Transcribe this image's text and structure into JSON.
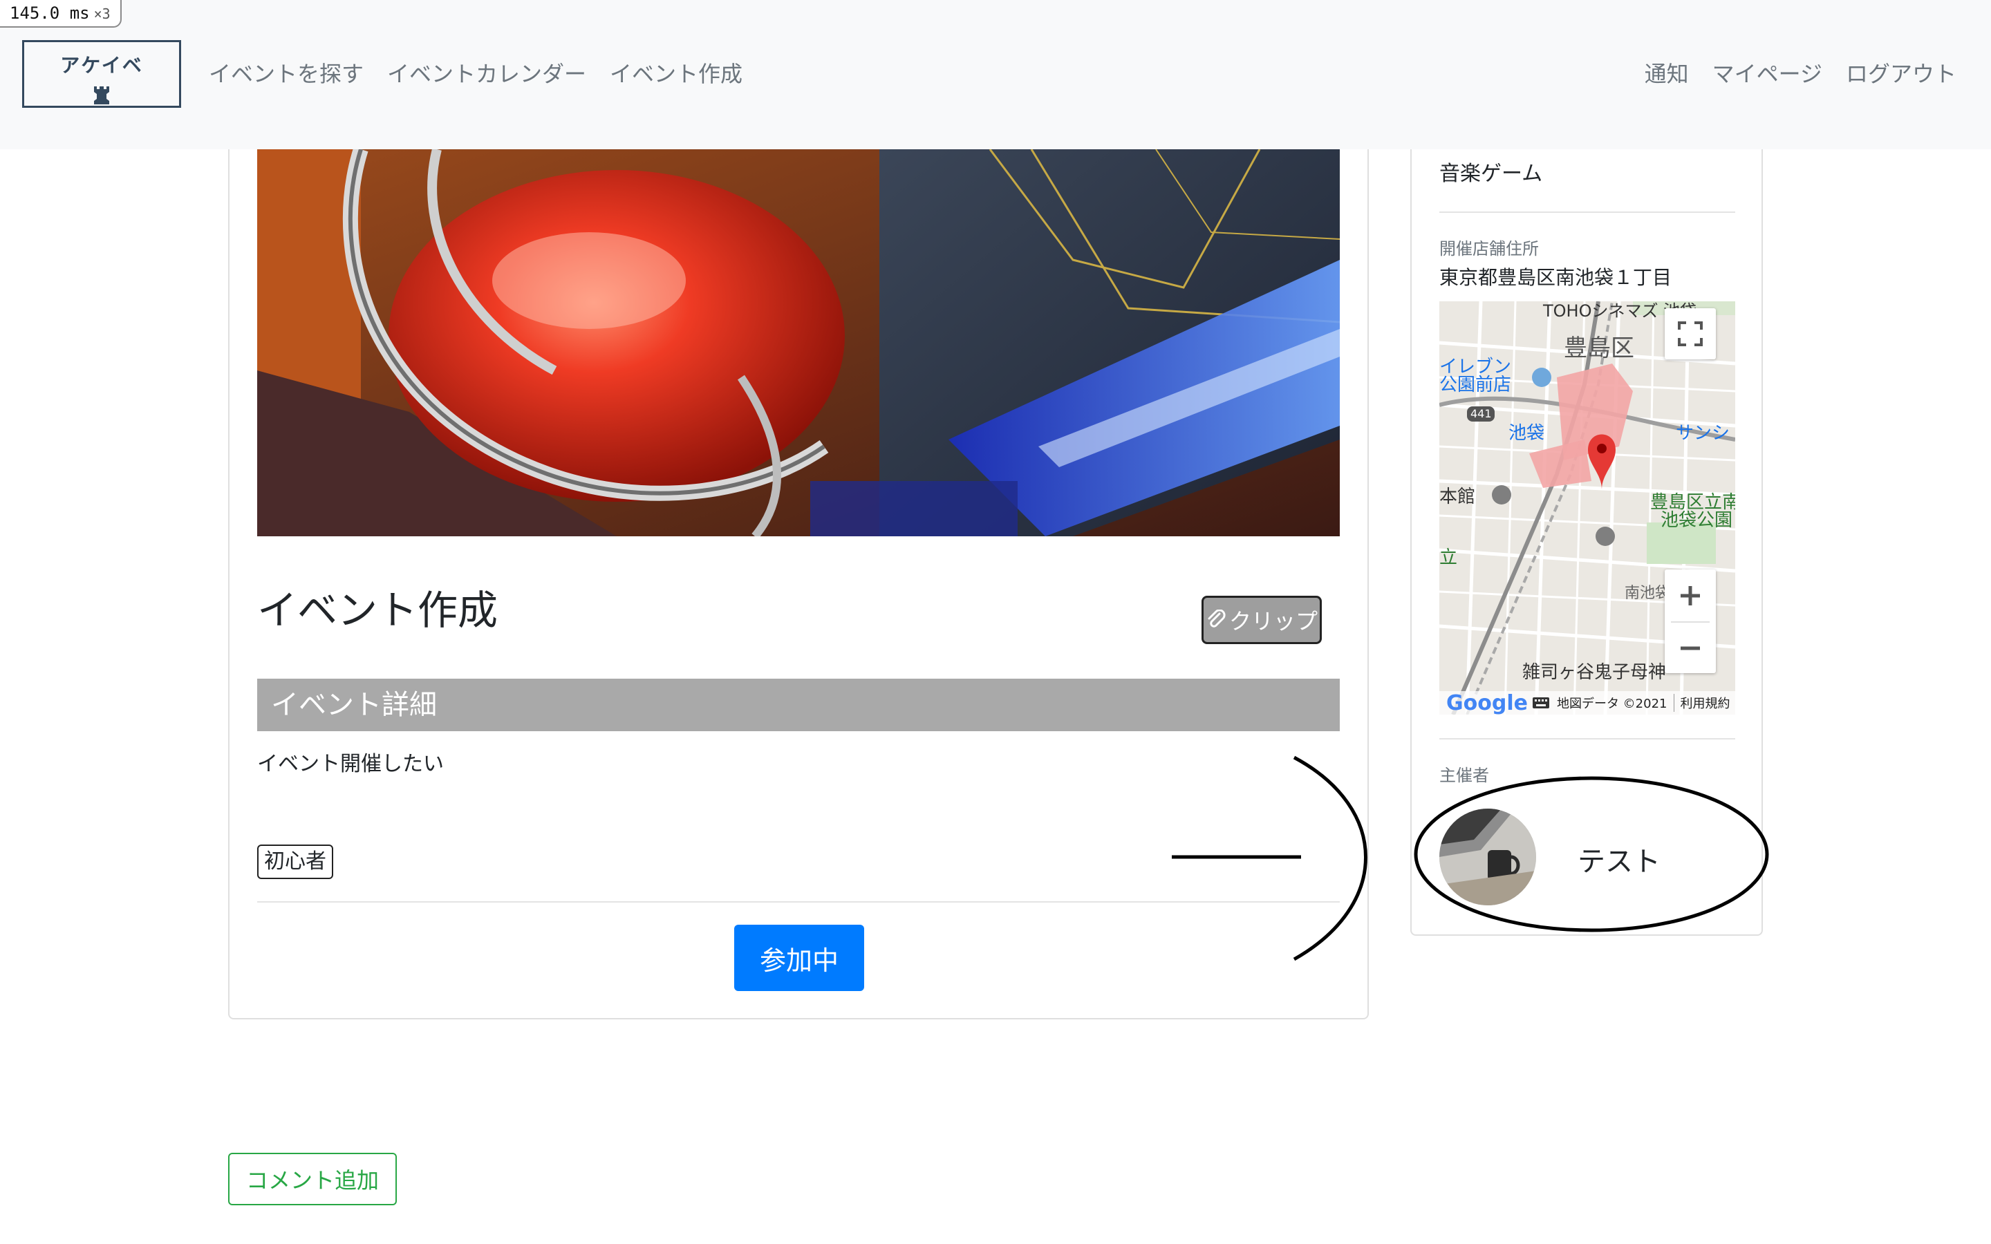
{
  "perf": {
    "ms": "145.0 ms",
    "multiplier": "×3"
  },
  "navbar": {
    "brand": "アケイベ",
    "brand_icon": "chess-rook-icon",
    "left_links": [
      "イベントを探す",
      "イベントカレンダー",
      "イベント作成"
    ],
    "right_links": [
      "通知",
      "マイページ",
      "ログアウト"
    ]
  },
  "event": {
    "title": "イベント作成",
    "clip_label": "クリップ",
    "clip_icon": "paperclip-icon",
    "details_heading": "イベント詳細",
    "description": "イベント開催したい",
    "tag": "初心者",
    "join_label": "参加中"
  },
  "sidebar": {
    "genre": "音楽ゲーム",
    "shop_label": "開催店舗住所",
    "shop_address": "東京都豊島区南池袋１丁目",
    "map": {
      "labels": {
        "top": "TOHOシネマズ 池袋",
        "ward": "豊島区",
        "seven": "イレブン",
        "park_front": "公園前店",
        "route": "441",
        "station": "池袋",
        "sunshine": "サンシ",
        "honkan": "本館",
        "toshima_park1": "豊島区立南",
        "toshima_park2": "池袋公園",
        "tate": "立",
        "minami": "南池袋",
        "zoshigaya": "雑司ヶ谷鬼子母神"
      },
      "footer_data": "地図データ ©2021",
      "footer_terms": "利用規約",
      "google": "Google"
    },
    "host_label": "主催者",
    "host_name": "テスト"
  },
  "comment_button": "コメント追加",
  "colors": {
    "navbar_bg": "#f8f9fa",
    "brand": "#34495e",
    "primary": "#007bff",
    "success": "#28a745",
    "section_bar": "#a9a9a9",
    "clip_bg": "#9e9e9e"
  }
}
